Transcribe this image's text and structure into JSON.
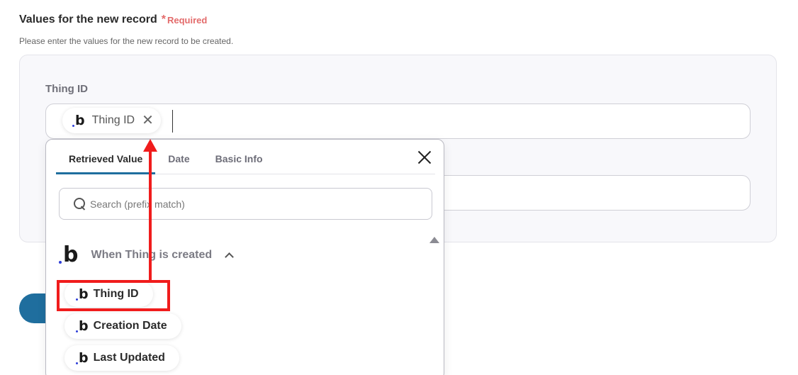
{
  "section": {
    "title": "Values for the new record",
    "required_label": "Required",
    "description": "Please enter the values for the new record to be created."
  },
  "field": {
    "label": "Thing ID",
    "chip_label": "Thing ID"
  },
  "dropdown": {
    "tabs": [
      "Retrieved Value",
      "Date",
      "Basic Info"
    ],
    "search_placeholder": "Search (prefix match)",
    "group_label": "When Thing is created",
    "items": [
      "Thing ID",
      "Creation Date",
      "Last Updated"
    ]
  },
  "colors": {
    "accent": "#1f6e9e",
    "required": "#e36b6b",
    "highlight": "#f01c1c"
  },
  "icons": {
    "service": "bubble-b-icon",
    "remove": "close-icon",
    "search": "search-icon",
    "collapse": "chevron-up-icon"
  }
}
